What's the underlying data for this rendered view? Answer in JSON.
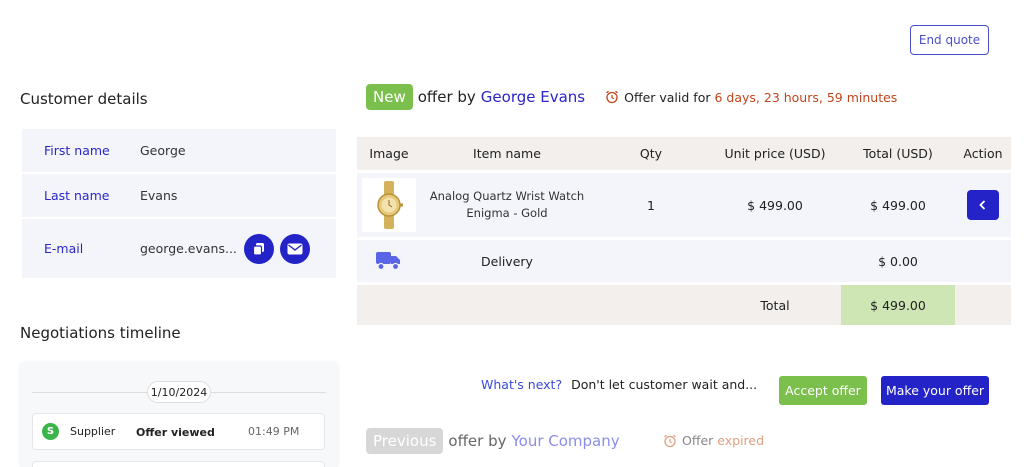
{
  "header": {
    "end_quote_label": "End quote"
  },
  "customer": {
    "title": "Customer details",
    "first_name_label": "First name",
    "first_name": "George",
    "last_name_label": "Last name",
    "last_name": "Evans",
    "email_label": "E-mail",
    "email": "george.evans..."
  },
  "timeline": {
    "title": "Negotiations timeline",
    "date": "1/10/2024",
    "entries": [
      {
        "avatar": "S",
        "actor": "Supplier",
        "event": "Offer viewed",
        "time": "01:49 PM"
      }
    ]
  },
  "offer": {
    "badge": "New",
    "by_text": "offer by",
    "customer_name": "George Evans",
    "valid_text": "Offer valid for",
    "valid_time": "6 days, 23 hours, 59 minutes",
    "icon": "alarm-clock-icon"
  },
  "table": {
    "headers": [
      "Image",
      "Item name",
      "Qty",
      "Unit price (USD)",
      "Total (USD)",
      "Action"
    ],
    "item": {
      "name_line1": "Analog Quartz Wrist Watch",
      "name_line2": "Enigma - Gold",
      "qty": "1",
      "unit_price": "$ 499.00",
      "total": "$ 499.00"
    },
    "delivery": {
      "label": "Delivery",
      "total": "$ 0.00"
    },
    "total": {
      "label": "Total",
      "value": "$ 499.00"
    }
  },
  "next": {
    "question": "What's next?",
    "text": "Don't let customer wait and...",
    "accept_label": "Accept offer",
    "make_label": "Make your offer"
  },
  "previous": {
    "badge": "Previous",
    "by_text": "offer by",
    "company": "Your Company",
    "offer_word": "Offer",
    "status": "expired"
  },
  "colors": {
    "primary": "#2323c8",
    "green": "#7bbf4c",
    "countdown": "#c0451c",
    "link": "#3b49d9"
  }
}
